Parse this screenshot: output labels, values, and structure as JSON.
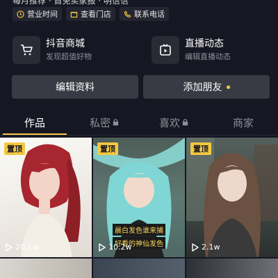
{
  "top_text": "每月推荐 · 首免卖家报 · 明信信",
  "chips": [
    {
      "icon": "clock-icon",
      "label": "营业时间"
    },
    {
      "icon": "store-icon",
      "label": "查看门店"
    },
    {
      "icon": "phone-icon",
      "label": "联系电话"
    }
  ],
  "cards": [
    {
      "icon": "cart-icon",
      "title": "抖音商城",
      "subtitle": "发现超值好物"
    },
    {
      "icon": "live-icon",
      "title": "直播动态",
      "subtitle": "编辑直播动态"
    }
  ],
  "buttons": {
    "edit": "编辑资料",
    "add_friend": "添加朋友"
  },
  "tabs": [
    {
      "label": "作品",
      "locked": false,
      "active": true
    },
    {
      "label": "私密",
      "locked": true,
      "active": false
    },
    {
      "label": "喜欢",
      "locked": true,
      "active": false
    },
    {
      "label": "商家",
      "locked": false,
      "active": false
    }
  ],
  "videos": [
    {
      "badge": "置顶",
      "plays": "20.1w"
    },
    {
      "badge": "置顶",
      "plays": "10.2w",
      "caption": [
        "晨白发色谁来捕",
        "好看的神仙发色"
      ]
    },
    {
      "badge": "置顶",
      "plays": "2.1w"
    }
  ],
  "colors": {
    "background": "#161722",
    "accent": "#f7c844",
    "button": "#393b44"
  }
}
